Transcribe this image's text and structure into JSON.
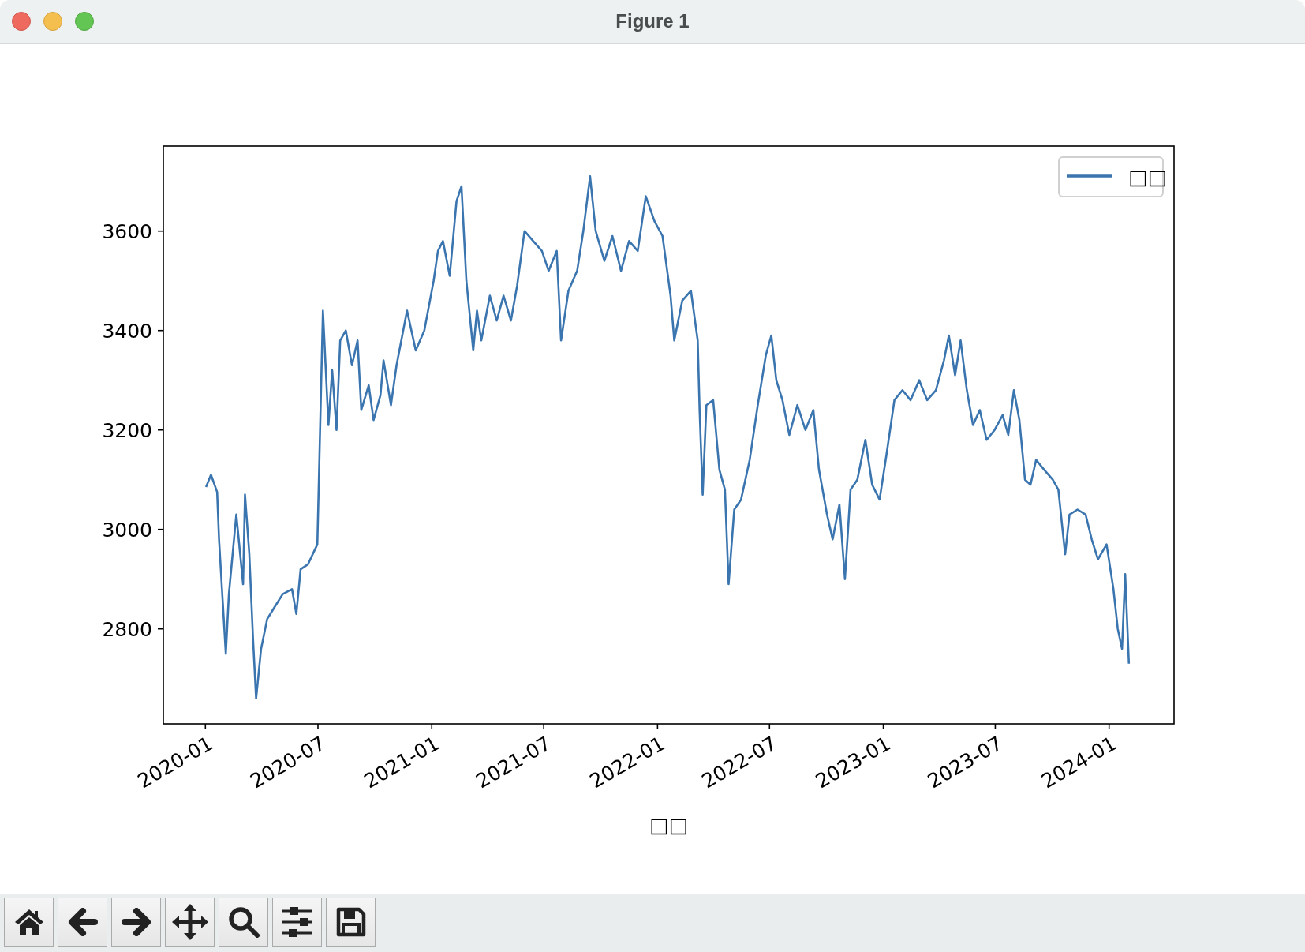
{
  "window": {
    "title": "Figure 1"
  },
  "figure": {
    "chart_data": {
      "type": "line",
      "xlabel": "□□",
      "x": [
        "2020-01-02",
        "2020-01-10",
        "2020-01-20",
        "2020-01-23",
        "2020-02-03",
        "2020-02-08",
        "2020-02-20",
        "2020-03-02",
        "2020-03-05",
        "2020-03-12",
        "2020-03-18",
        "2020-03-23",
        "2020-03-31",
        "2020-04-10",
        "2020-04-20",
        "2020-05-05",
        "2020-05-20",
        "2020-05-27",
        "2020-06-03",
        "2020-06-15",
        "2020-06-30",
        "2020-07-09",
        "2020-07-18",
        "2020-07-24",
        "2020-07-31",
        "2020-08-06",
        "2020-08-15",
        "2020-08-25",
        "2020-09-03",
        "2020-09-09",
        "2020-09-21",
        "2020-09-29",
        "2020-10-10",
        "2020-10-15",
        "2020-10-27",
        "2020-11-05",
        "2020-11-22",
        "2020-12-06",
        "2020-12-20",
        "2021-01-04",
        "2021-01-11",
        "2021-01-19",
        "2021-01-30",
        "2021-02-10",
        "2021-02-18",
        "2021-02-26",
        "2021-03-09",
        "2021-03-15",
        "2021-03-22",
        "2021-04-05",
        "2021-04-16",
        "2021-04-27",
        "2021-05-09",
        "2021-05-19",
        "2021-05-31",
        "2021-06-14",
        "2021-06-28",
        "2021-07-09",
        "2021-07-22",
        "2021-07-29",
        "2021-08-10",
        "2021-08-24",
        "2021-09-03",
        "2021-09-14",
        "2021-09-23",
        "2021-10-07",
        "2021-10-20",
        "2021-11-03",
        "2021-11-16",
        "2021-11-30",
        "2021-12-13",
        "2021-12-27",
        "2022-01-09",
        "2022-01-22",
        "2022-01-28",
        "2022-02-10",
        "2022-02-24",
        "2022-03-07",
        "2022-03-10",
        "2022-03-15",
        "2022-03-21",
        "2022-04-01",
        "2022-04-11",
        "2022-04-20",
        "2022-04-26",
        "2022-05-05",
        "2022-05-16",
        "2022-05-30",
        "2022-06-12",
        "2022-06-25",
        "2022-07-04",
        "2022-07-12",
        "2022-07-22",
        "2022-08-02",
        "2022-08-15",
        "2022-08-28",
        "2022-09-10",
        "2022-09-19",
        "2022-10-02",
        "2022-10-11",
        "2022-10-22",
        "2022-10-31",
        "2022-11-09",
        "2022-11-20",
        "2022-12-03",
        "2022-12-14",
        "2022-12-26",
        "2023-01-06",
        "2023-01-19",
        "2023-02-01",
        "2023-02-14",
        "2023-02-28",
        "2023-03-13",
        "2023-03-27",
        "2023-04-09",
        "2023-04-17",
        "2023-04-27",
        "2023-05-06",
        "2023-05-16",
        "2023-05-26",
        "2023-06-06",
        "2023-06-17",
        "2023-06-30",
        "2023-07-13",
        "2023-07-22",
        "2023-07-31",
        "2023-08-09",
        "2023-08-18",
        "2023-08-27",
        "2023-09-05",
        "2023-09-18",
        "2023-10-02",
        "2023-10-11",
        "2023-10-22",
        "2023-10-29",
        "2023-11-11",
        "2023-11-24",
        "2023-12-04",
        "2023-12-14",
        "2023-12-28",
        "2024-01-08",
        "2024-01-15",
        "2024-01-22",
        "2024-01-27",
        "2024-02-02"
      ],
      "series": [
        {
          "name": "□□",
          "color": "#3b75af",
          "values": [
            3085,
            3110,
            3075,
            2980,
            2750,
            2870,
            3030,
            2890,
            3070,
            2950,
            2780,
            2660,
            2760,
            2820,
            2840,
            2870,
            2880,
            2830,
            2920,
            2930,
            2970,
            3440,
            3210,
            3320,
            3200,
            3380,
            3400,
            3330,
            3380,
            3240,
            3290,
            3220,
            3270,
            3340,
            3250,
            3330,
            3440,
            3360,
            3400,
            3500,
            3560,
            3580,
            3510,
            3660,
            3690,
            3500,
            3360,
            3440,
            3380,
            3470,
            3420,
            3470,
            3420,
            3490,
            3600,
            3580,
            3560,
            3520,
            3560,
            3380,
            3480,
            3520,
            3600,
            3710,
            3600,
            3540,
            3590,
            3520,
            3580,
            3560,
            3670,
            3620,
            3590,
            3470,
            3380,
            3460,
            3480,
            3380,
            3240,
            3070,
            3250,
            3260,
            3120,
            3080,
            2890,
            3040,
            3060,
            3140,
            3250,
            3350,
            3390,
            3300,
            3260,
            3190,
            3250,
            3200,
            3240,
            3120,
            3030,
            2980,
            3050,
            2900,
            3080,
            3100,
            3180,
            3090,
            3060,
            3150,
            3260,
            3280,
            3260,
            3300,
            3260,
            3280,
            3340,
            3390,
            3310,
            3380,
            3280,
            3210,
            3240,
            3180,
            3200,
            3230,
            3190,
            3280,
            3220,
            3100,
            3090,
            3140,
            3120,
            3100,
            3080,
            2950,
            3030,
            3040,
            3030,
            2980,
            2940,
            2970,
            2880,
            2800,
            2760,
            2910,
            2730
          ]
        }
      ],
      "xlim": [
        "2019-10-25",
        "2024-04-15"
      ],
      "ylim": [
        2609,
        3771
      ],
      "xticks": [
        {
          "value": "2020-01-01",
          "label": "2020-01"
        },
        {
          "value": "2020-07-01",
          "label": "2020-07"
        },
        {
          "value": "2021-01-01",
          "label": "2021-01"
        },
        {
          "value": "2021-07-01",
          "label": "2021-07"
        },
        {
          "value": "2022-01-01",
          "label": "2022-01"
        },
        {
          "value": "2022-07-01",
          "label": "2022-07"
        },
        {
          "value": "2023-01-01",
          "label": "2023-01"
        },
        {
          "value": "2023-07-01",
          "label": "2023-07"
        },
        {
          "value": "2024-01-01",
          "label": "2024-01"
        }
      ],
      "yticks": [
        2800,
        3000,
        3200,
        3400,
        3600
      ]
    }
  }
}
